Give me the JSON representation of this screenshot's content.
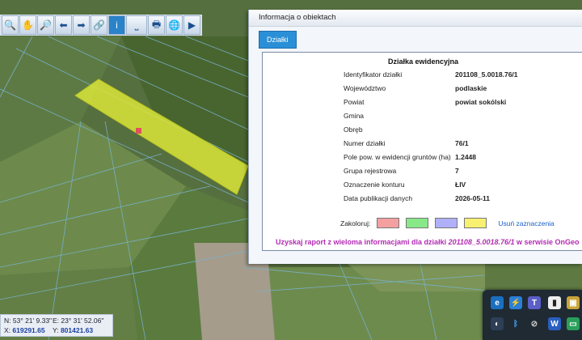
{
  "toolbar": {
    "items": [
      {
        "icon": "zoom-out-icon",
        "glyph": "🔍"
      },
      {
        "icon": "pan-hand-icon",
        "glyph": "✋"
      },
      {
        "icon": "zoom-in-icon",
        "glyph": "🔎"
      },
      {
        "icon": "back-arrow-icon",
        "glyph": "⬅"
      },
      {
        "icon": "forward-arrow-icon",
        "glyph": "➡"
      },
      {
        "icon": "link-icon",
        "glyph": "🔗"
      },
      {
        "icon": "info-icon",
        "glyph": "i"
      },
      {
        "icon": "measure-ruler-icon",
        "glyph": "⎵"
      },
      {
        "icon": "print-icon",
        "glyph": "🖶"
      },
      {
        "icon": "globe-icon",
        "glyph": "🌐"
      },
      {
        "icon": "video-camera-icon",
        "glyph": "▶"
      }
    ]
  },
  "coords": {
    "n": "N:  53° 21' 9.33\"",
    "e": "E:  23° 31' 52.06\"",
    "x_label": "X:",
    "x": "619291.65",
    "y_label": "Y:",
    "y": "801421.63"
  },
  "panel": {
    "title": "Informacja o obiektach",
    "tab": "Działki",
    "heading": "Działka ewidencyjna",
    "rows": [
      {
        "label": "Identyfikator działki",
        "value": "201108_5.0018.76/1"
      },
      {
        "label": "Województwo",
        "value": "podlaskie"
      },
      {
        "label": "Powiat",
        "value": "powiat sokólski"
      },
      {
        "label": "Gmina",
        "value": ""
      },
      {
        "label": "Obręb",
        "value": ""
      },
      {
        "label": "Numer działki",
        "value": "76/1"
      },
      {
        "label": "Pole pow. w ewidencji gruntów (ha)",
        "value": "1.2448"
      },
      {
        "label": "Grupa rejestrowa",
        "value": "7"
      },
      {
        "label": "Oznaczenie konturu",
        "value": "ŁIV"
      },
      {
        "label": "Data publikacji danych",
        "value": "2026-05-11"
      }
    ],
    "color_label": "Zakoloruj:",
    "swatches": [
      "#f4a0a0",
      "#88e888",
      "#b0b0f8",
      "#f8f070"
    ],
    "clear_label": "Usuń zaznaczenia",
    "report_prefix": "Uzyskaj raport z wieloma informacjami dla działki ",
    "report_parcel": "201108_5.0018.76/1",
    "report_suffix": " w serwisie OnGeo"
  },
  "colors": {
    "highlight_parcel": "#d9e63a",
    "tab_blue": "#2a8fd6",
    "report_magenta": "#b32bb3"
  }
}
